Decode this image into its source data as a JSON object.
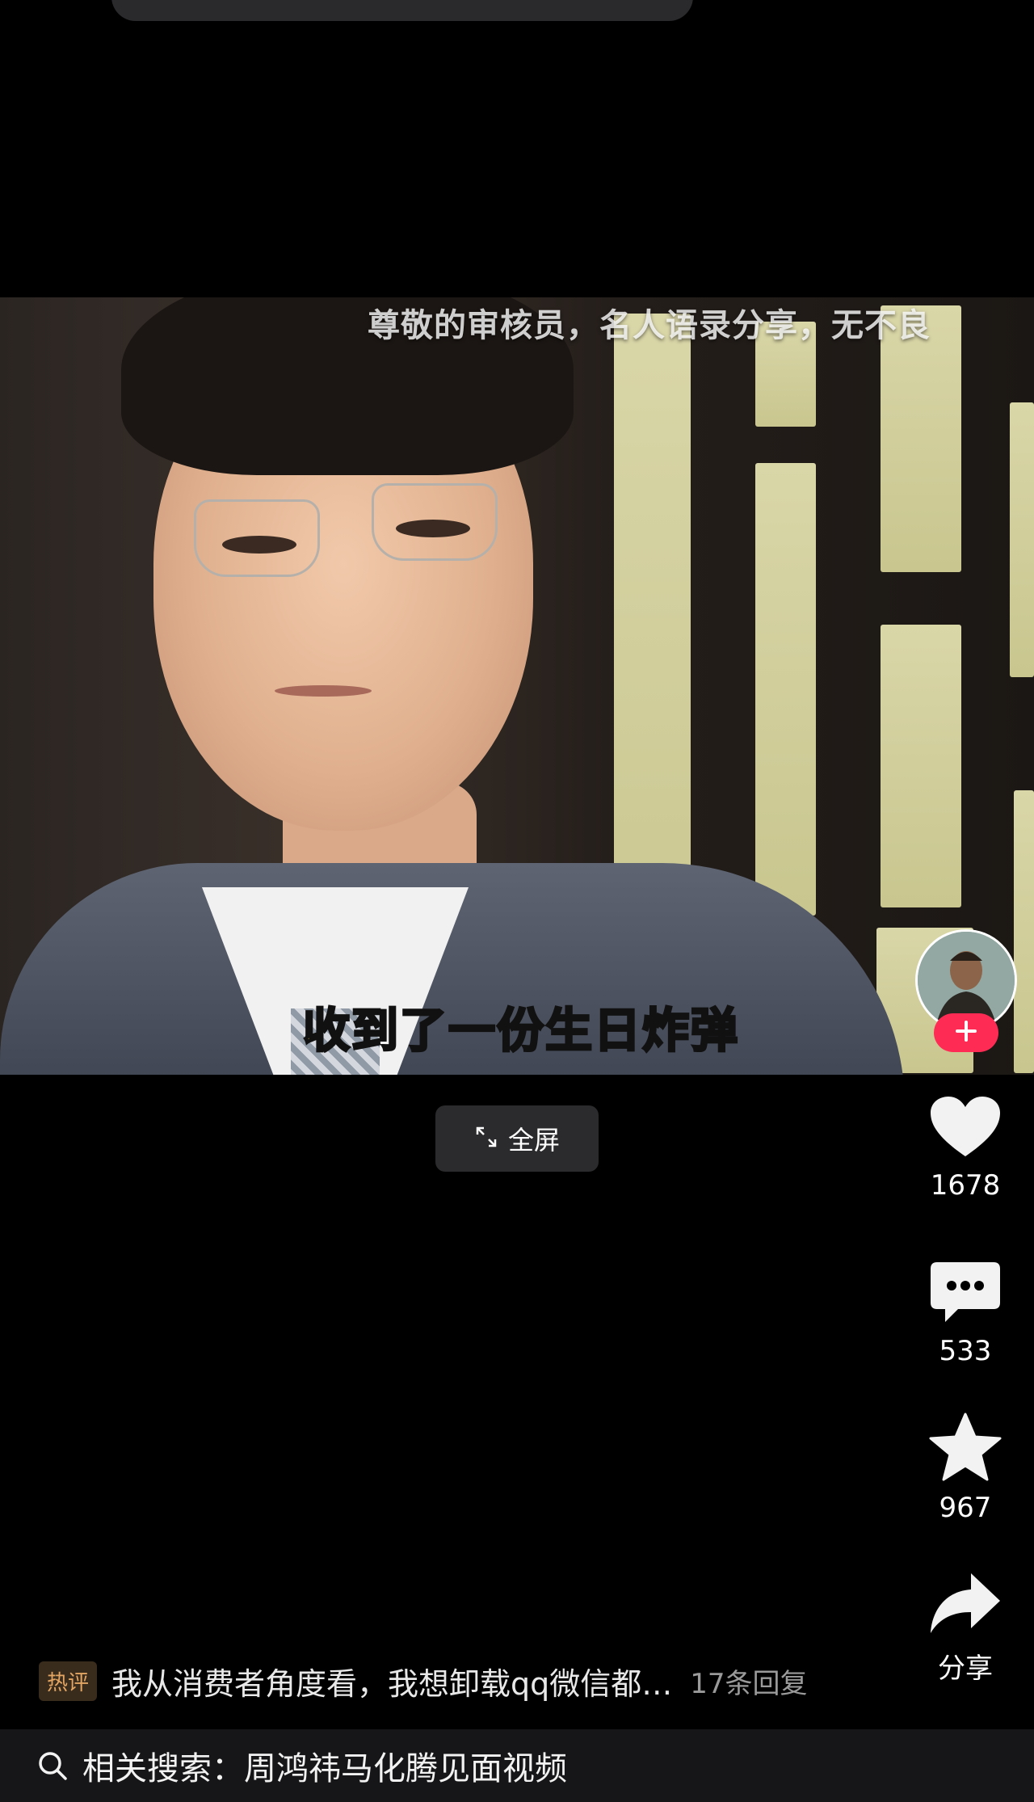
{
  "video": {
    "watermark": "尊敬的审核员，名人语录分享，无不良",
    "subtitle": "收到了一份生日炸弹"
  },
  "fullscreen": {
    "label": "全屏",
    "icon": "expand-icon"
  },
  "actions": {
    "like": {
      "count": "1678",
      "icon": "heart-icon"
    },
    "comment": {
      "count": "533",
      "icon": "comment-icon"
    },
    "favorite": {
      "count": "967",
      "icon": "star-icon"
    },
    "share": {
      "label": "分享",
      "icon": "share-icon"
    },
    "follow": {
      "icon": "plus-icon",
      "color": "#fe2c55"
    }
  },
  "hot_comment": {
    "badge": "热评",
    "text": "我从消费者角度看，我想卸载qq微信都…",
    "replies": "17条回复"
  },
  "related_search": {
    "label": "相关搜索：周鸿祎马化腾见面视频",
    "icon": "search-icon"
  }
}
